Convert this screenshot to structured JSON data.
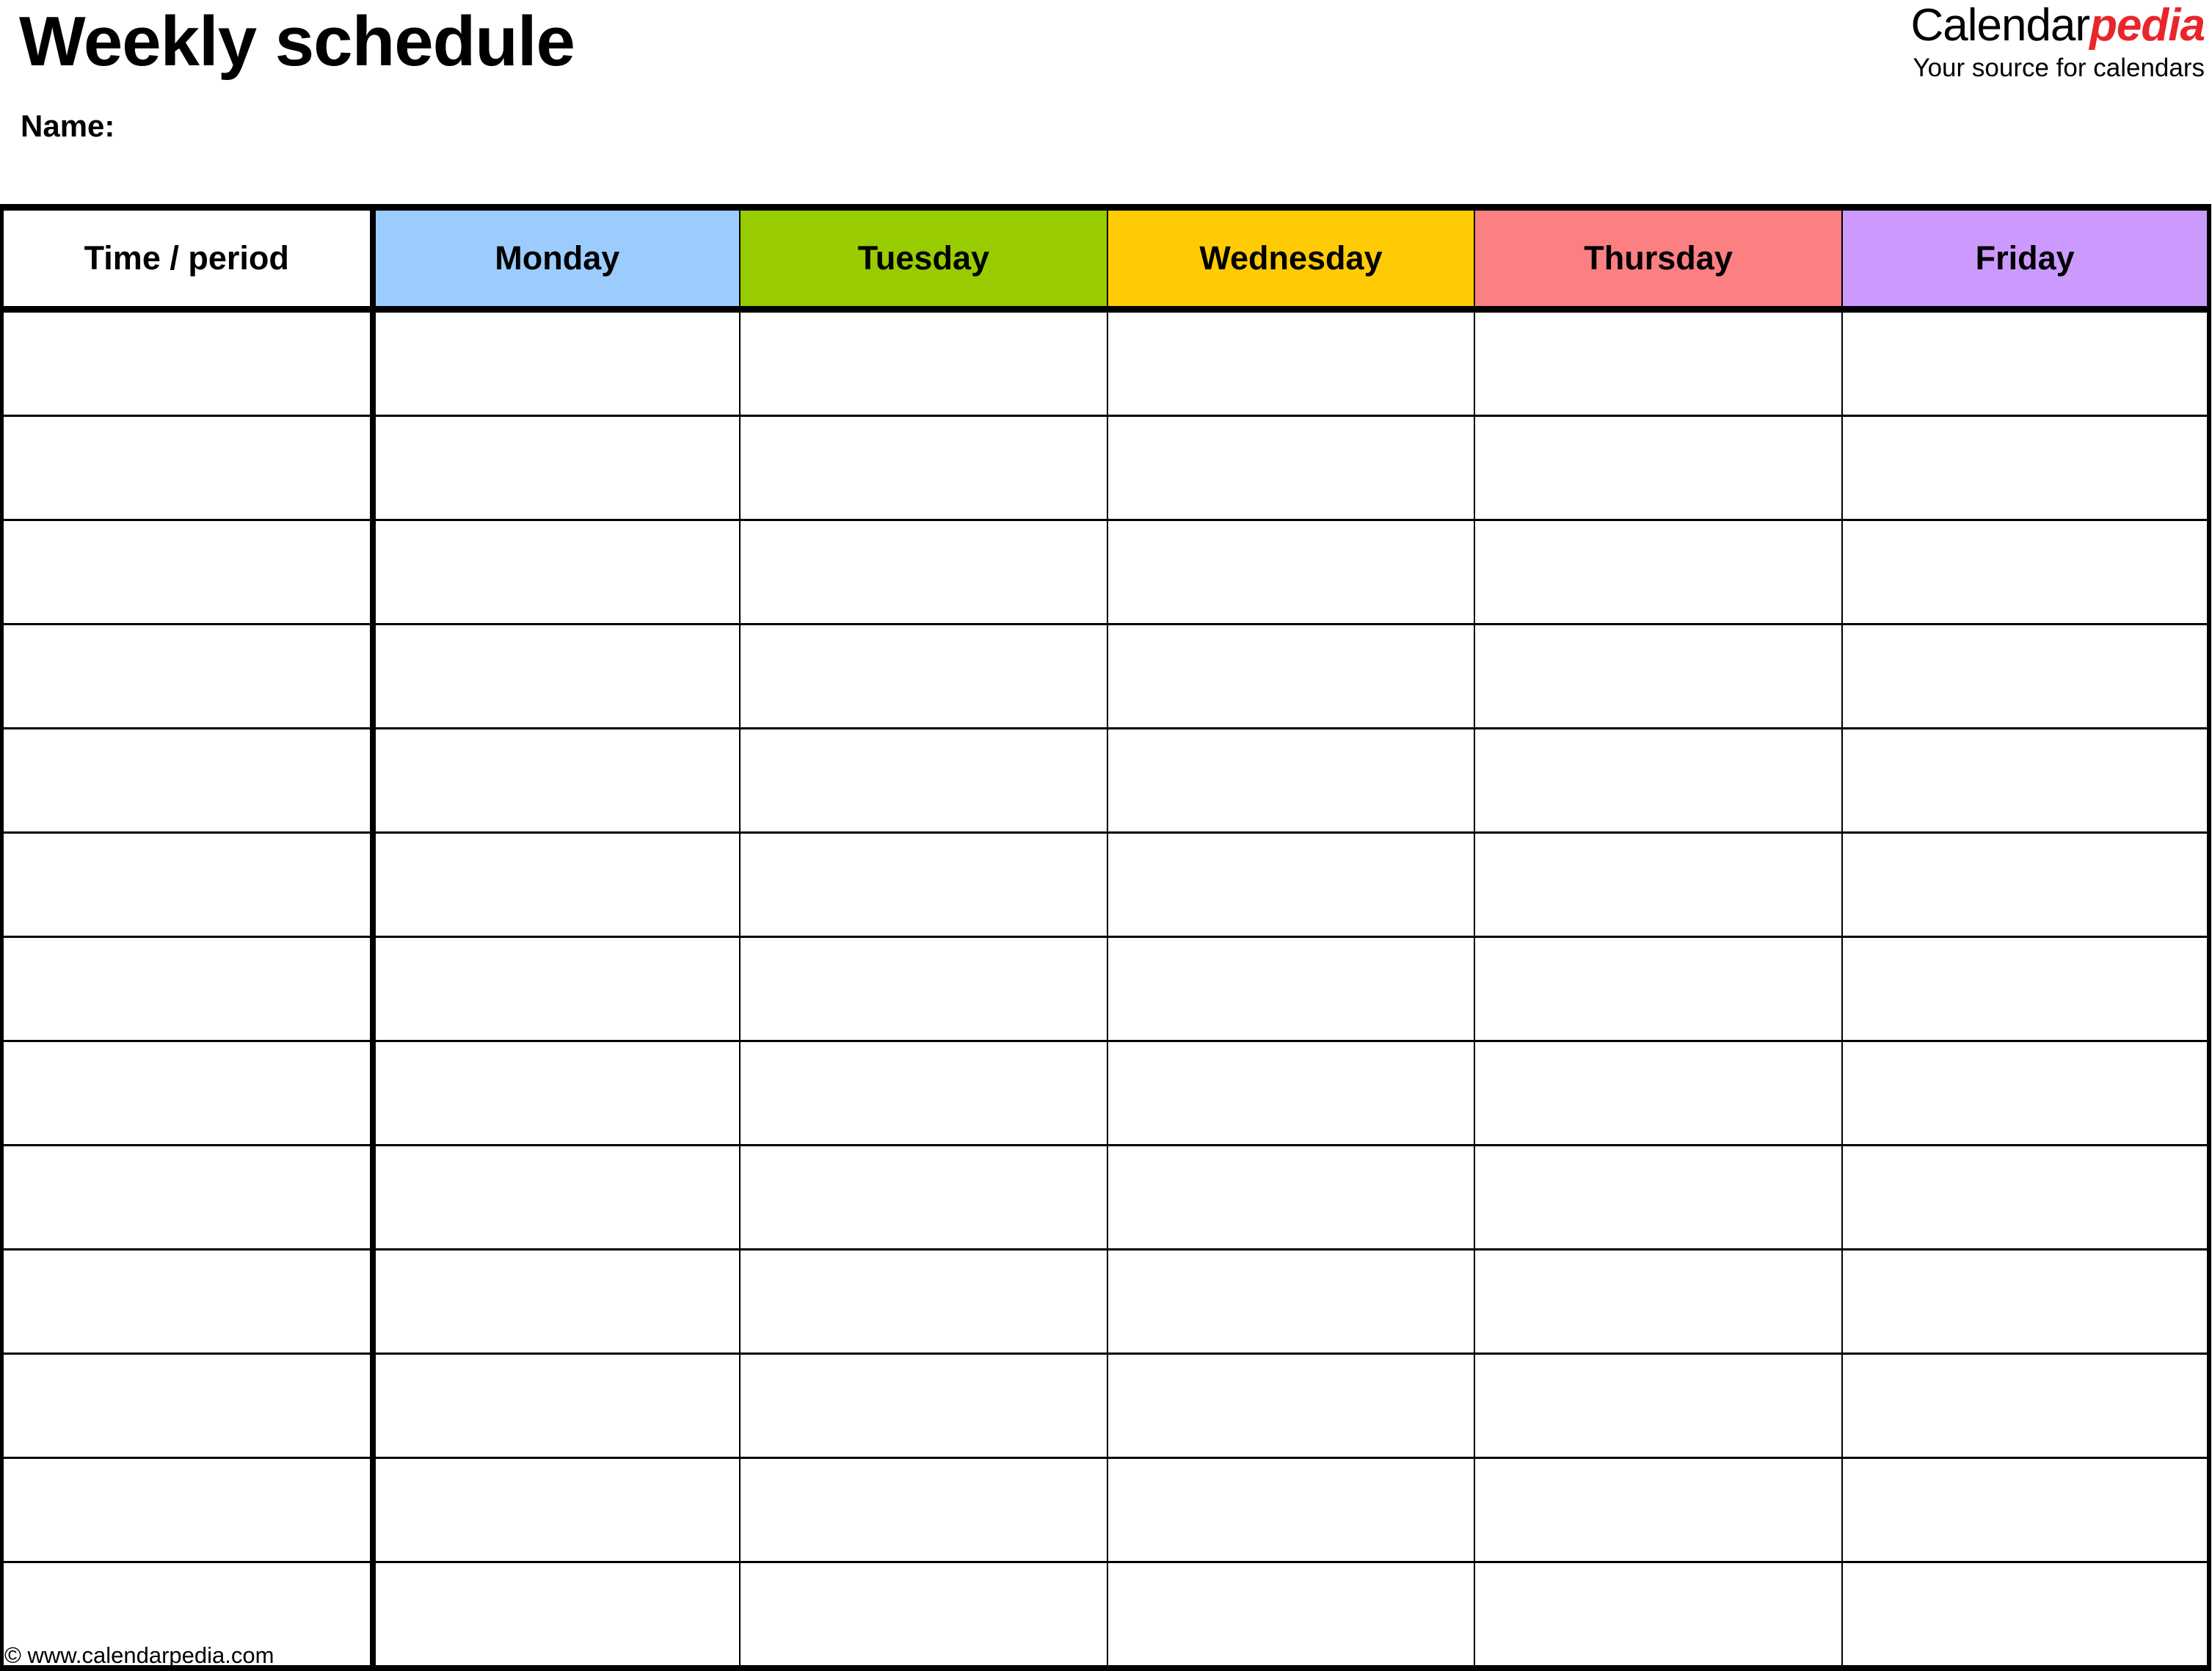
{
  "document": {
    "title": "Weekly schedule",
    "name_label": "Name:"
  },
  "brand": {
    "word_part_1": "Calendar",
    "word_part_2": "pedia",
    "tagline": "Your source for calendars",
    "accent_color": "#e8262a"
  },
  "table": {
    "columns": [
      {
        "id": "time",
        "label": "Time / period",
        "bg": "#ffffff"
      },
      {
        "id": "monday",
        "label": "Monday",
        "bg": "#9bccfd"
      },
      {
        "id": "tuesday",
        "label": "Tuesday",
        "bg": "#99cc00"
      },
      {
        "id": "wednesday",
        "label": "Wednesday",
        "bg": "#ffcb05"
      },
      {
        "id": "thursday",
        "label": "Thursday",
        "bg": "#fc7f82"
      },
      {
        "id": "friday",
        "label": "Friday",
        "bg": "#cc99ff"
      }
    ],
    "row_count": 13,
    "rows": [
      {
        "time": "",
        "monday": "",
        "tuesday": "",
        "wednesday": "",
        "thursday": "",
        "friday": ""
      },
      {
        "time": "",
        "monday": "",
        "tuesday": "",
        "wednesday": "",
        "thursday": "",
        "friday": ""
      },
      {
        "time": "",
        "monday": "",
        "tuesday": "",
        "wednesday": "",
        "thursday": "",
        "friday": ""
      },
      {
        "time": "",
        "monday": "",
        "tuesday": "",
        "wednesday": "",
        "thursday": "",
        "friday": ""
      },
      {
        "time": "",
        "monday": "",
        "tuesday": "",
        "wednesday": "",
        "thursday": "",
        "friday": ""
      },
      {
        "time": "",
        "monday": "",
        "tuesday": "",
        "wednesday": "",
        "thursday": "",
        "friday": ""
      },
      {
        "time": "",
        "monday": "",
        "tuesday": "",
        "wednesday": "",
        "thursday": "",
        "friday": ""
      },
      {
        "time": "",
        "monday": "",
        "tuesday": "",
        "wednesday": "",
        "thursday": "",
        "friday": ""
      },
      {
        "time": "",
        "monday": "",
        "tuesday": "",
        "wednesday": "",
        "thursday": "",
        "friday": ""
      },
      {
        "time": "",
        "monday": "",
        "tuesday": "",
        "wednesday": "",
        "thursday": "",
        "friday": ""
      },
      {
        "time": "",
        "monday": "",
        "tuesday": "",
        "wednesday": "",
        "thursday": "",
        "friday": ""
      },
      {
        "time": "",
        "monday": "",
        "tuesday": "",
        "wednesday": "",
        "thursday": "",
        "friday": ""
      },
      {
        "time": "",
        "monday": "",
        "tuesday": "",
        "wednesday": "",
        "thursday": "",
        "friday": ""
      }
    ]
  },
  "footer": {
    "copyright": "© www.calendarpedia.com"
  }
}
